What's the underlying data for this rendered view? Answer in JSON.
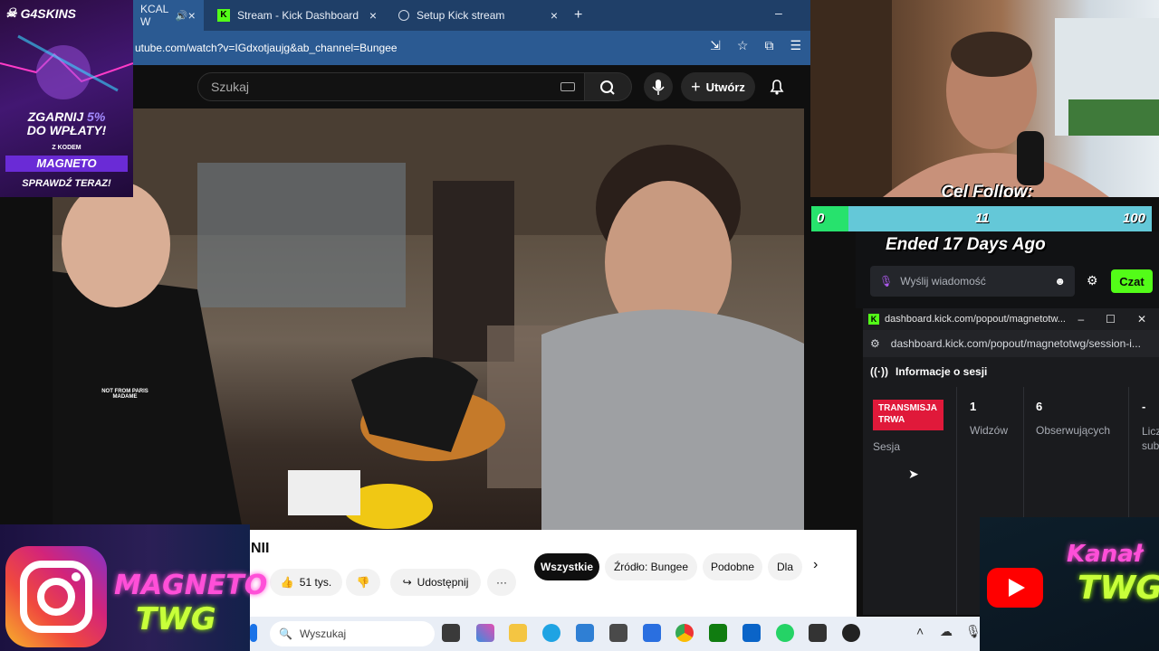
{
  "browser": {
    "tabs": [
      {
        "label": "KCAL W",
        "active": true
      },
      {
        "label": "Stream - Kick Dashboard",
        "active": false
      },
      {
        "label": "Setup Kick stream",
        "active": false
      }
    ],
    "url": "utube.com/watch?v=IGdxotjaujg&ab_channel=Bungee"
  },
  "youtube": {
    "search_placeholder": "Szukaj",
    "create_label": "Utwórz",
    "video_title_fragment": "NII",
    "likes": "51 tys.",
    "share_label": "Udostępnij",
    "more_label": "···",
    "chips": [
      "Wszystkie",
      "Źródło: Bungee",
      "Podobne",
      "Dla"
    ],
    "shirt_text": "NOT FROM PARIS MADAME"
  },
  "ad": {
    "brand": "G4SKINS",
    "headline": "ZGARNIJ",
    "bonus": "5%",
    "headline2": "DO WPŁATY!",
    "code_label": "Z KODEM",
    "code": "MAGNETO",
    "cta": "SPRAWDŹ TERAZ!"
  },
  "goal": {
    "title": "Cel Follow:",
    "min": "0",
    "current": "11",
    "max": "100",
    "progress_fraction": 0.11,
    "status": "Ended 17 Days Ago"
  },
  "chat": {
    "placeholder": "Wyślij wiadomość",
    "send_label": "Czat"
  },
  "popout": {
    "window_title": "dashboard.kick.com/popout/magnetotw...",
    "url": "dashboard.kick.com/popout/magnetotwg/session-i...",
    "header": "Informacje o sesji",
    "live_badge": "TRANSMISJA TRWA",
    "session_label": "Sesja",
    "stats": [
      {
        "value": "1",
        "label": "Widzów"
      },
      {
        "value": "6",
        "label": "Obserwujących"
      },
      {
        "value": "-",
        "label": "Licz sub"
      }
    ]
  },
  "overlays": {
    "ig_text1": "MAGNETO",
    "ig_text2": "TWG",
    "yt_text1": "Kanał",
    "yt_text2": "TWG"
  },
  "taskbar": {
    "search_placeholder": "Wyszukaj"
  },
  "colors": {
    "kick_green": "#53fc18",
    "goal_bar": "#64c8d8",
    "goal_fill": "#27e26d",
    "live_red": "#e0193a"
  }
}
